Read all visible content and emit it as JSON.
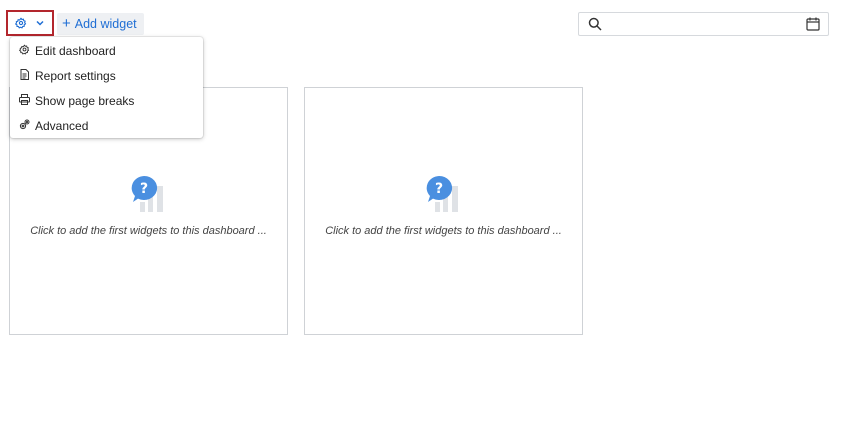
{
  "toolbar": {
    "settings_icon": "gear-icon",
    "dropdown_icon": "chevron-down-icon",
    "add_widget_label": "Add widget",
    "add_widget_icon": "plus-icon",
    "accent": "#1f6ed4",
    "highlight_border": "#b3262d"
  },
  "search": {
    "placeholder": "",
    "value": "",
    "search_icon": "search-icon",
    "calendar_icon": "calendar-icon"
  },
  "menu": {
    "items": [
      {
        "label": "Edit dashboard",
        "icon": "gear-icon"
      },
      {
        "label": "Report settings",
        "icon": "document-icon"
      },
      {
        "label": "Show page breaks",
        "icon": "printer-icon"
      },
      {
        "label": "Advanced",
        "icon": "gears-icon"
      }
    ]
  },
  "widgets": [
    {
      "hint": "Click to add the first widgets to this dashboard ...",
      "icon": "question-chart-icon"
    },
    {
      "hint": "Click to add the first widgets to this dashboard ...",
      "icon": "question-chart-icon"
    }
  ]
}
